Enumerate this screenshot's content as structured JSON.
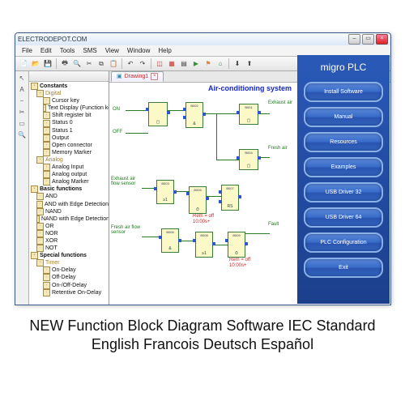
{
  "window": {
    "title": "ELECTRODEPOT.COM"
  },
  "menu": [
    "File",
    "Edit",
    "Tools",
    "SMS",
    "View",
    "Window",
    "Help"
  ],
  "tree": {
    "header": "",
    "root": "Constants",
    "digital": {
      "label": "Digital",
      "items": [
        "Cursor key",
        "Text Display (Function keys)",
        "Shift register bit",
        "Status 0",
        "Status 1",
        "Output",
        "Open connector",
        "Memory Marker"
      ]
    },
    "analog": {
      "label": "Analog",
      "items": [
        "Analog Input",
        "Analog output",
        "Analog Marker"
      ]
    },
    "basic": {
      "label": "Basic functions",
      "items": [
        "AND",
        "AND with Edge Detection",
        "NAND",
        "NAND with Edge Detection",
        "OR",
        "NOR",
        "XOR",
        "NOT"
      ]
    },
    "special": {
      "label": "Special functions",
      "timer": "Timer",
      "timer_items": [
        "On-Delay",
        "Off-Delay",
        "On-/Off-Delay",
        "Retentive On-Delay"
      ]
    }
  },
  "tab": "Drawing1",
  "diagram": {
    "title": "Air-conditioning system",
    "labels": {
      "on": "ON",
      "off": "OFF",
      "exhaust1": "Exhaust air",
      "fresh1": "Fresh air",
      "exhaust2": "Exhaust air flow sensor",
      "fresh2": "Fresh air flow sensor",
      "fault": "Fault",
      "rem": "Rem = off",
      "time": "10:00s+"
    },
    "blocks": [
      "B001",
      "B002",
      "B003",
      "B004",
      "B005",
      "B006",
      "B007",
      "B008",
      "B009"
    ]
  },
  "sidepanel": {
    "title": "migro PLC",
    "buttons": [
      "Install Software",
      "Manual",
      "Resources",
      "Examples",
      "USB Driver 32",
      "USB Driver 64",
      "PLC Configuration",
      "Exit"
    ]
  },
  "caption": {
    "line1": "NEW Function Block Diagram Software  IEC Standard",
    "line2": "English   Francois   Deutsch   Español"
  }
}
